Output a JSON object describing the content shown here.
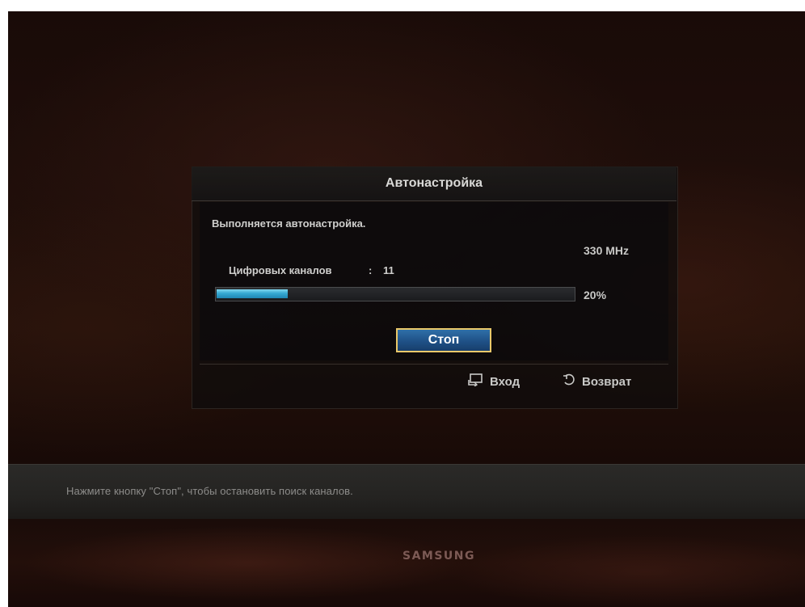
{
  "dialog": {
    "title": "Автонастройка",
    "status": "Выполняется автонастройка.",
    "frequency": "330 MHz",
    "channels_label": "Цифровых каналов",
    "channels_separator": ":",
    "channels_count": "11",
    "progress_percent": 20,
    "progress_text": "20%",
    "stop_label": "Стоп",
    "footer": {
      "enter_label": "Вход",
      "enter_icon": "enter-icon",
      "return_label": "Возврат",
      "return_icon": "return-icon"
    }
  },
  "help_bar": {
    "text": "Нажмите кнопку \"Стоп\", чтобы остановить поиск каналов."
  },
  "tv": {
    "brand": "SAMSUNG"
  },
  "colors": {
    "progress_fill": "#35a9d2",
    "stop_button_bg": "#1f5187",
    "focus_border": "#e9c86a"
  }
}
